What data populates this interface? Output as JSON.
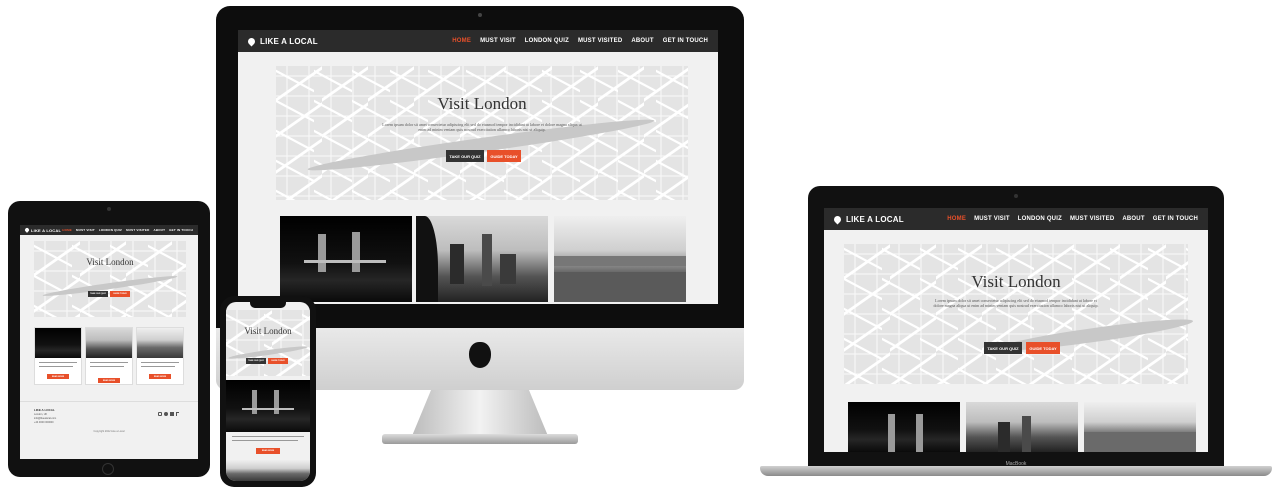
{
  "site": {
    "brand": "LIKE A LOCAL",
    "nav": [
      "HOME",
      "MUST VISIT",
      "LONDON QUIZ",
      "MUST VISITED",
      "ABOUT",
      "GET IN TOUCH"
    ],
    "hero_title": "Visit London",
    "hero_text": "Lorem ipsum dolor sit amet consectetur adipiscing elit sed do eiusmod tempor incididunt ut labore et dolore magna aliqua ut enim ad minim veniam quis nostrud exercitation ullamco laboris nisi ut aliquip.",
    "btn_quiz": "TAKE OUR QUIZ",
    "btn_guide": "GUIDE TODAY",
    "card_button": "READ MORE",
    "footer_brand": "LIKE A LOCAL",
    "footer_lines": [
      "London, UK",
      "info@likealocal.com",
      "+44 0000 000000"
    ],
    "footer_copyright": "Copyright 2022 Like a Local",
    "social_icons": [
      "instagram-icon",
      "facebook-icon",
      "linkedin-icon",
      "tiktok-icon"
    ]
  },
  "devices": {
    "laptop_label": "MacBook"
  },
  "colors": {
    "nav_bg": "#2b2b2b",
    "accent": "#e8502a",
    "dark_button": "#333333"
  }
}
